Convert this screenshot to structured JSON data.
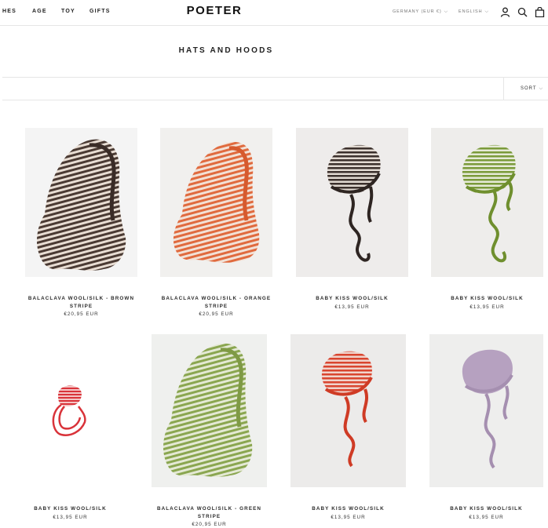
{
  "nav": {
    "items": [
      {
        "label": "HES"
      },
      {
        "label": "AGE"
      },
      {
        "label": "TOY"
      },
      {
        "label": "GIFTS"
      }
    ],
    "brand": "POETER",
    "country": "GERMANY (EUR €)",
    "language": "ENGLISH",
    "icons": [
      "account-icon",
      "search-icon",
      "cart-icon"
    ]
  },
  "collection": {
    "title": "HATS AND HOODS",
    "sort_label": "SORT"
  },
  "products": [
    {
      "name": "BALACLAVA WOOL/SILK - BROWN STRIPE",
      "price": "€20,95 EUR",
      "kind": "balaclava",
      "color": "#4a3a33"
    },
    {
      "name": "BALACLAVA WOOL/SILK - ORANGE STRIPE",
      "price": "€20,95 EUR",
      "kind": "balaclava",
      "color": "#e06a3e"
    },
    {
      "name": "BABY KISS WOOL/SILK",
      "price": "€13,95 EUR",
      "kind": "bonnet",
      "color": "#3b302c"
    },
    {
      "name": "BABY KISS WOOL/SILK",
      "price": "€13,95 EUR",
      "kind": "bonnet",
      "color": "#7a9a3a"
    },
    {
      "name": "BABY KISS WOOL/SILK",
      "price": "€13,95 EUR",
      "kind": "bonnet-small",
      "color": "#d9333a"
    },
    {
      "name": "BALACLAVA WOOL/SILK - GREEN STRIPE",
      "price": "€20,95 EUR",
      "kind": "balaclava",
      "color": "#8aa650"
    },
    {
      "name": "BABY KISS WOOL/SILK",
      "price": "€13,95 EUR",
      "kind": "bonnet",
      "color": "#d9452f"
    },
    {
      "name": "BABY KISS WOOL/SILK",
      "price": "€13,95 EUR",
      "kind": "bonnet",
      "color": "#b6a1c0"
    }
  ]
}
